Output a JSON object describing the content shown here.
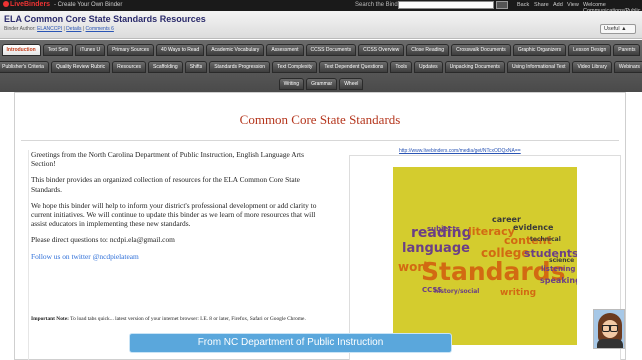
{
  "topbar": {
    "logo": "LiveBinders",
    "tagline": "- Create Your Own Binder",
    "search_label": "Search the Binders",
    "nav": [
      "Back",
      "Share",
      "Add",
      "View",
      "Welcome Communications/Public"
    ]
  },
  "binder": {
    "title": "ELA Common Core State Standards Resources",
    "meta_prefix": "Binder Author:",
    "author": "ELANCCPI",
    "details": "Details",
    "comments": "Comments 6",
    "useful_label": "Useful"
  },
  "tabs_row1": [
    "Introduction",
    "Text Sets",
    "iTunes U",
    "Primary Sources",
    "40 Ways to Read",
    "Academic Vocabulary",
    "Assessment",
    "CCSS Documents",
    "CCSS Overview",
    "Close Reading",
    "Crosswalk Documents",
    "Graphic Organizers",
    "Lesson Design",
    "Parents"
  ],
  "tabs_row2": [
    "Publisher's Criteria",
    "Quality Review Rubric",
    "Resources",
    "Scaffolding",
    "Shifts",
    "Standards Progression",
    "Text Complexity",
    "Text Dependent Questions",
    "Tools",
    "Updates",
    "Unpacking Documents",
    "Using Informational Text",
    "Video Library",
    "Webinars"
  ],
  "tabs_row3": [
    "Writing",
    "Grammar",
    "Wheel"
  ],
  "content": {
    "heading": "Common Core State Standards",
    "p1": "Greetings from the North Carolina Department of Public Instruction, English Language Arts Section!",
    "p2": "This binder provides an organized collection of resources for the ELA Common Core State Standards.",
    "p3": "We hope this binder will help to inform your district's professional development or add clarity to current initiatives. We will continue to update this binder as we learn of more resources that will assist educators in implementing these new standards.",
    "p4": "Please direct questions to: ncdpi.ela@gmail.com",
    "twitter": "Follow us on twitter @ncdpielateam",
    "important_label": "Important Note:",
    "important_text": "To load tabs quick... latest version of your internet browser: I.E. 8 or later, Firefox, Safari or Google Chrome.",
    "image_url": "http://www.livebinders.com/media/get/NTcxODQxNA=="
  },
  "wordcloud": {
    "background": "#d4cc2e",
    "words": [
      {
        "text": "reading",
        "color": "#6b3f86"
      },
      {
        "text": "literacy",
        "color": "#d26a12"
      },
      {
        "text": "content",
        "color": "#d26a12"
      },
      {
        "text": "evidence",
        "color": "#3a3a3a"
      },
      {
        "text": "career",
        "color": "#3a3a3a"
      },
      {
        "text": "language",
        "color": "#6b3f86"
      },
      {
        "text": "college",
        "color": "#d26a12"
      },
      {
        "text": "students",
        "color": "#6b3f86"
      },
      {
        "text": "Standards",
        "color": "#d26a12"
      },
      {
        "text": "work",
        "color": "#d26a12"
      },
      {
        "text": "subjects",
        "color": "#6b3f86"
      },
      {
        "text": "speaking",
        "color": "#6b3f86"
      },
      {
        "text": "writing",
        "color": "#d26a12"
      },
      {
        "text": "listening",
        "color": "#6b3f86"
      },
      {
        "text": "technical",
        "color": "#3a3a3a"
      },
      {
        "text": "history/social",
        "color": "#6b3f86"
      },
      {
        "text": "CCSS",
        "color": "#6b3f86"
      },
      {
        "text": "science",
        "color": "#3a3a3a"
      }
    ]
  },
  "caption": "From NC Department of Public Instruction"
}
